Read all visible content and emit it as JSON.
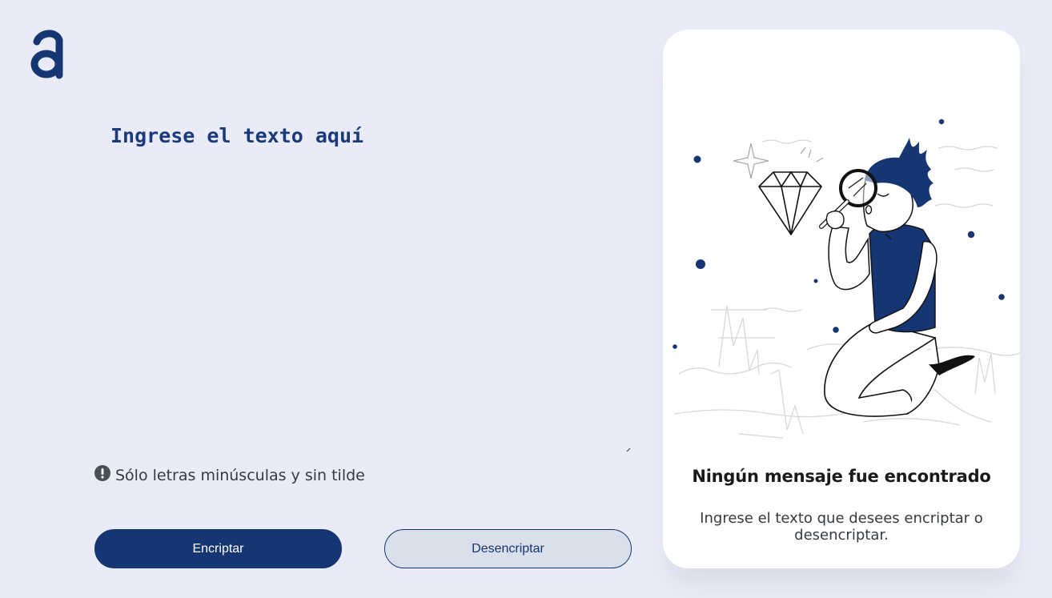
{
  "brand": {
    "logo": "alura-a-logo",
    "color": "#163673"
  },
  "editor": {
    "placeholder": "Ingrese el texto aquí",
    "value": ""
  },
  "hint": {
    "icon": "exclamation-circle-icon",
    "text": "Sólo letras minúsculas y sin tilde"
  },
  "actions": {
    "encrypt_label": "Encriptar",
    "decrypt_label": "Desencriptar"
  },
  "output": {
    "title": "Ningún mensaje fue encontrado",
    "description": "Ingrese el texto que desees encriptar o desencriptar."
  },
  "colors": {
    "background": "#e9ecf8",
    "primary": "#163673",
    "secondary_button": "#d9dfeb",
    "panel": "#ffffff"
  }
}
